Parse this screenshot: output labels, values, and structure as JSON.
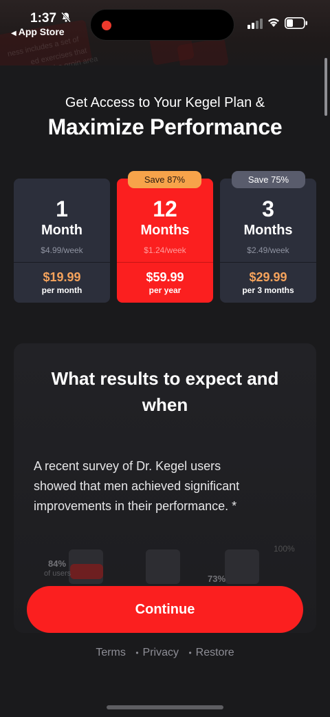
{
  "status_bar": {
    "time": "1:37",
    "back_label": "App Store"
  },
  "banner_text": [
    "ness includes a set of",
    "ed exercises that",
    "he groin area"
  ],
  "header": {
    "subtitle": "Get Access to Your Kegel Plan &",
    "title": "Maximize Performance"
  },
  "plans": [
    {
      "num": "1",
      "unit": "Month",
      "weekly": "$4.99/week",
      "price": "$19.99",
      "period": "per month",
      "badge": ""
    },
    {
      "num": "12",
      "unit": "Months",
      "weekly": "$1.24/week",
      "price": "$59.99",
      "period": "per year",
      "badge": "Save 87%",
      "selected": true
    },
    {
      "num": "3",
      "unit": "Months",
      "weekly": "$2.49/week",
      "price": "$29.99",
      "period": "per 3 months",
      "badge": "Save 75%"
    }
  ],
  "results": {
    "title_line1": "What results to expect and",
    "title_line2": "when",
    "body_line1": "A recent survey of Dr. Kegel users",
    "body_line2": "showed that men achieved significant",
    "body_line3": "improvements in their performance. *",
    "chart_pct1": "84%",
    "chart_sub1": "of users",
    "chart_pct2": "73%",
    "chart_top": "100%"
  },
  "continue_label": "Continue",
  "footer": {
    "terms": "Terms",
    "privacy": "Privacy",
    "restore": "Restore",
    "sep": "•"
  },
  "colors": {
    "accent_red": "#fb1f1f",
    "price_orange": "#f5a35c",
    "badge_orange": "#f7a34a",
    "card_bg": "#2c2f3b",
    "page_bg": "#1a1a1c"
  }
}
